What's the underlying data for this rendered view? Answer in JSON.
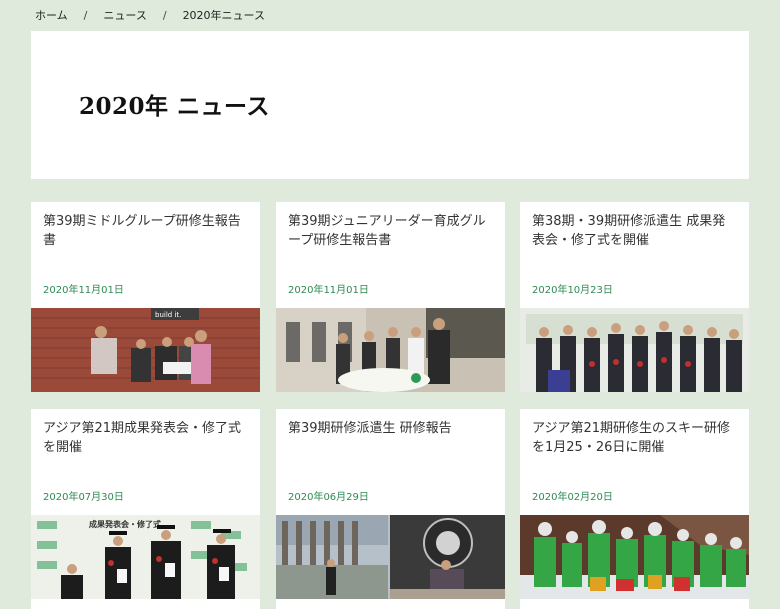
{
  "breadcrumb": {
    "home": "ホーム",
    "separator": "/",
    "news": "ニュース",
    "current": "2020年ニュース"
  },
  "hero": {
    "title": "2020年 ニュース"
  },
  "cards": [
    {
      "title": "第39期ミドルグループ研修生報告書",
      "date": "2020年11月01日",
      "image_sign": "build it."
    },
    {
      "title": "第39期ジュニアリーダー育成グループ研修生報告書",
      "date": "2020年11月01日"
    },
    {
      "title": "第38期・39期研修派遣生 成果発表会・修了式を開催",
      "date": "2020年10月23日"
    },
    {
      "title": "アジア第21期成果発表会・修了式を開催",
      "date": "2020年07月30日",
      "image_banner": "成果発表会・修了式"
    },
    {
      "title": "第39期研修派遣生 研修報告",
      "date": "2020年06月29日"
    },
    {
      "title": "アジア第21期研修生のスキー研修を1月25・26日に開催",
      "date": "2020年02月20日"
    }
  ],
  "colors": {
    "page_background": "#dfe9dc",
    "card_background": "#ffffff",
    "date_green": "#2f8a53"
  }
}
